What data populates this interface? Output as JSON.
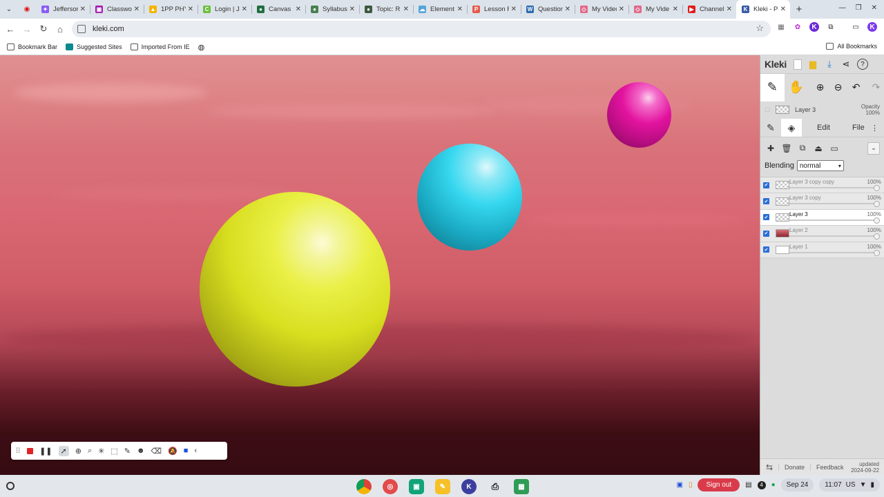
{
  "browser": {
    "tabs": [
      {
        "label": "Jeffersor",
        "color": "#8b5cf6",
        "glyph": "✦"
      },
      {
        "label": "Classwo",
        "color": "#a21caf",
        "glyph": "▣"
      },
      {
        "label": "1PP PHY",
        "color": "#f4b400",
        "glyph": "▲"
      },
      {
        "label": "Login | J",
        "color": "#6bbf3b",
        "glyph": "C"
      },
      {
        "label": "Canvas",
        "color": "#1f6f43",
        "glyph": "●"
      },
      {
        "label": "Syllabus",
        "color": "#4b7f52",
        "glyph": "●"
      },
      {
        "label": "Topic: R",
        "color": "#3d5a40",
        "glyph": "●"
      },
      {
        "label": "Element",
        "color": "#57a5d8",
        "glyph": "☁"
      },
      {
        "label": "Lesson F",
        "color": "#e35b4d",
        "glyph": "P"
      },
      {
        "label": "Question",
        "color": "#2b6cb0",
        "glyph": "W"
      },
      {
        "label": "My Video",
        "color": "#e06a8a",
        "glyph": "◇"
      },
      {
        "label": "My Vide",
        "color": "#e06a8a",
        "glyph": "◇"
      },
      {
        "label": "Channel",
        "color": "#e11d1d",
        "glyph": "▶"
      },
      {
        "label": "Kleki - P",
        "color": "#3b5aa6",
        "glyph": "K"
      }
    ],
    "active_tab_index": 13,
    "url": "kleki.com",
    "bookmarks": [
      "Bookmark Bar",
      "Suggested Sites",
      "Imported From IE"
    ],
    "all_bookmarks_label": "All Bookmarks"
  },
  "kleki": {
    "logo": "Kleki",
    "current_layer": "Layer 3",
    "opacity_label": "Opacity",
    "opacity_value": "100%",
    "tabs": {
      "edit": "Edit",
      "file": "File"
    },
    "blending_label": "Blending",
    "blending_value": "normal",
    "layers": [
      {
        "name": "Layer 3 copy copy",
        "opacity": "100%",
        "selected": false,
        "thumb": "checker"
      },
      {
        "name": "Layer 3 copy",
        "opacity": "100%",
        "selected": false,
        "thumb": "checker"
      },
      {
        "name": "Layer 3",
        "opacity": "100%",
        "selected": true,
        "thumb": "checker"
      },
      {
        "name": "Layer 2",
        "opacity": "100%",
        "selected": false,
        "thumb": "red"
      },
      {
        "name": "Layer 1",
        "opacity": "100%",
        "selected": false,
        "thumb": "white"
      }
    ],
    "footer": {
      "donate": "Donate",
      "feedback": "Feedback",
      "updated_label": "updated",
      "updated_date": "2024-09-22"
    }
  },
  "shelf": {
    "sign_out": "Sign out",
    "notif_count": "4",
    "date": "Sep 24",
    "time": "11:07",
    "locale": "US"
  },
  "colors": {
    "sphere_yellow": "#e6ee24",
    "sphere_cyan": "#32d6ee",
    "sphere_magenta": "#e3139f",
    "accent_blue": "#2a6fd6",
    "signout_red": "#d93b4a"
  }
}
